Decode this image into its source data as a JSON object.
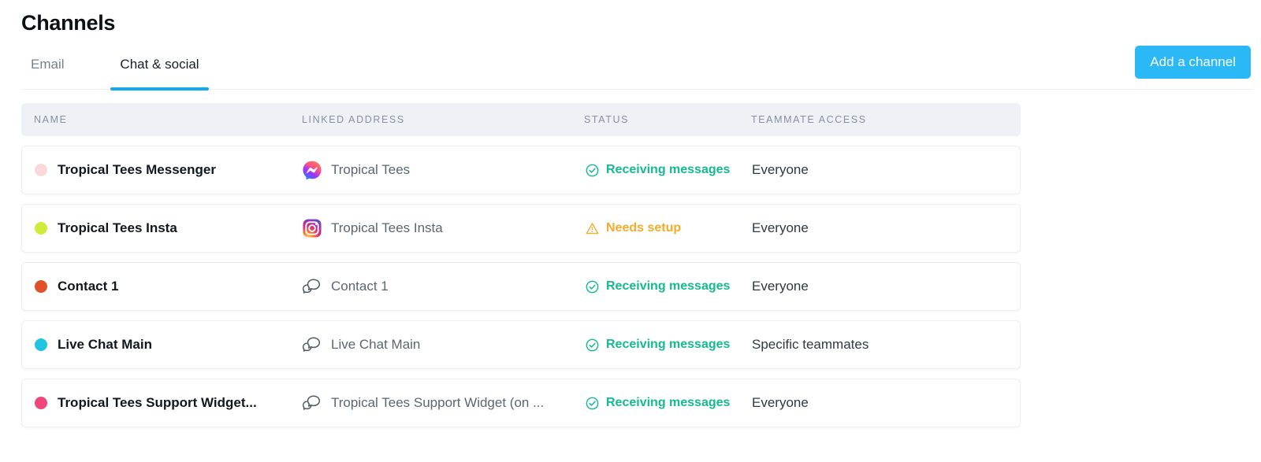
{
  "header": {
    "title": "Channels",
    "add_button_label": "Add a channel"
  },
  "tabs": [
    {
      "label": "Email",
      "active": false
    },
    {
      "label": "Chat & social",
      "active": true
    }
  ],
  "table": {
    "columns": [
      {
        "key": "name",
        "label": "Name"
      },
      {
        "key": "linked",
        "label": "Linked address"
      },
      {
        "key": "status",
        "label": "Status"
      },
      {
        "key": "access",
        "label": "Teammate access"
      }
    ],
    "rows": [
      {
        "dot_color": "#fbd8dc",
        "name": "Tropical Tees Messenger",
        "icon": "messenger-icon",
        "linked_address": "Tropical Tees",
        "status": "Receiving messages",
        "status_kind": "ok",
        "status_icon": "check-circle-icon",
        "teammate_access": "Everyone"
      },
      {
        "dot_color": "#d2ea3c",
        "name": "Tropical Tees Insta",
        "icon": "instagram-icon",
        "linked_address": "Tropical Tees Insta",
        "status": "Needs setup",
        "status_kind": "warn",
        "status_icon": "warning-triangle-icon",
        "teammate_access": "Everyone"
      },
      {
        "dot_color": "#e0512a",
        "name": "Contact 1",
        "icon": "chat-bubble-icon",
        "linked_address": "Contact 1",
        "status": "Receiving messages",
        "status_kind": "ok",
        "status_icon": "check-circle-icon",
        "teammate_access": "Everyone"
      },
      {
        "dot_color": "#20c4e0",
        "name": "Live Chat Main",
        "icon": "chat-bubble-icon",
        "linked_address": "Live Chat Main",
        "status": "Receiving messages",
        "status_kind": "ok",
        "status_icon": "check-circle-icon",
        "teammate_access": "Specific teammates"
      },
      {
        "dot_color": "#f0467a",
        "name": "Tropical Tees Support Widget...",
        "icon": "chat-bubble-icon",
        "linked_address": "Tropical Tees Support Widget (on ...",
        "status": "Receiving messages",
        "status_kind": "ok",
        "status_icon": "check-circle-icon",
        "teammate_access": "Everyone"
      }
    ]
  },
  "colors": {
    "accent": "#2bb8f7",
    "tab_underline": "#0fa9f4",
    "status_ok": "#13bb8e",
    "status_warn": "#f5ab2b",
    "header_bg": "#eef1f5"
  }
}
